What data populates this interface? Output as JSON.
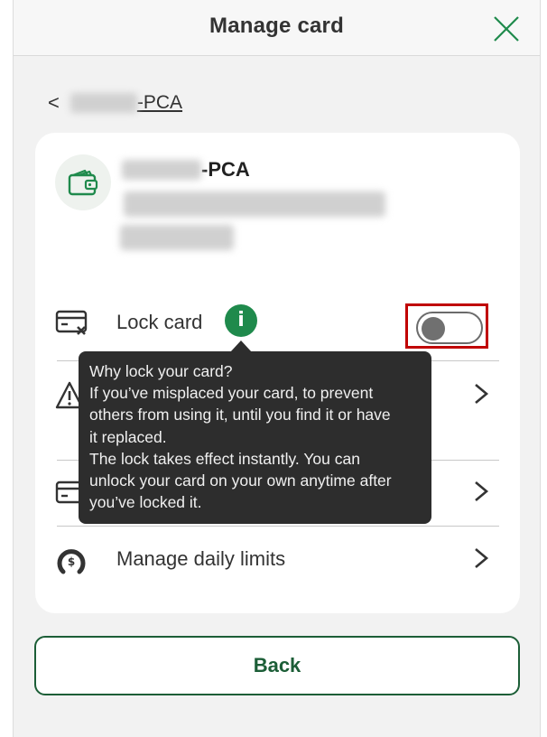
{
  "header": {
    "title": "Manage card",
    "close_icon": "close-icon"
  },
  "breadcrumb": {
    "back_chevron": "<",
    "account_suffix": "-PCA"
  },
  "account": {
    "name_suffix": "-PCA",
    "icon": "wallet-icon"
  },
  "rows": {
    "lock": {
      "label": "Lock card",
      "icon": "card-lock-icon",
      "info_glyph": "i",
      "toggle_on": false
    },
    "report": {
      "label": "",
      "icon": "warning-icon"
    },
    "replace": {
      "label": "",
      "icon": "card-icon"
    },
    "limits": {
      "label": "Manage daily limits",
      "icon": "dollar-gauge-icon"
    }
  },
  "tooltip": {
    "title": "Why lock your card?",
    "line1": "If you’ve misplaced your card, to prevent",
    "line2": "others from using it, until you find it or have",
    "line3": "it replaced.",
    "line4": "The lock takes effect instantly. You can",
    "line5": "unlock your card on your own anytime after",
    "line6": "you’ve locked it."
  },
  "back_button": {
    "label": "Back"
  },
  "colors": {
    "accent": "#1f8a4c",
    "button_border": "#1c5e37",
    "highlight": "#c00000",
    "tooltip_bg": "#2d2d2d"
  }
}
